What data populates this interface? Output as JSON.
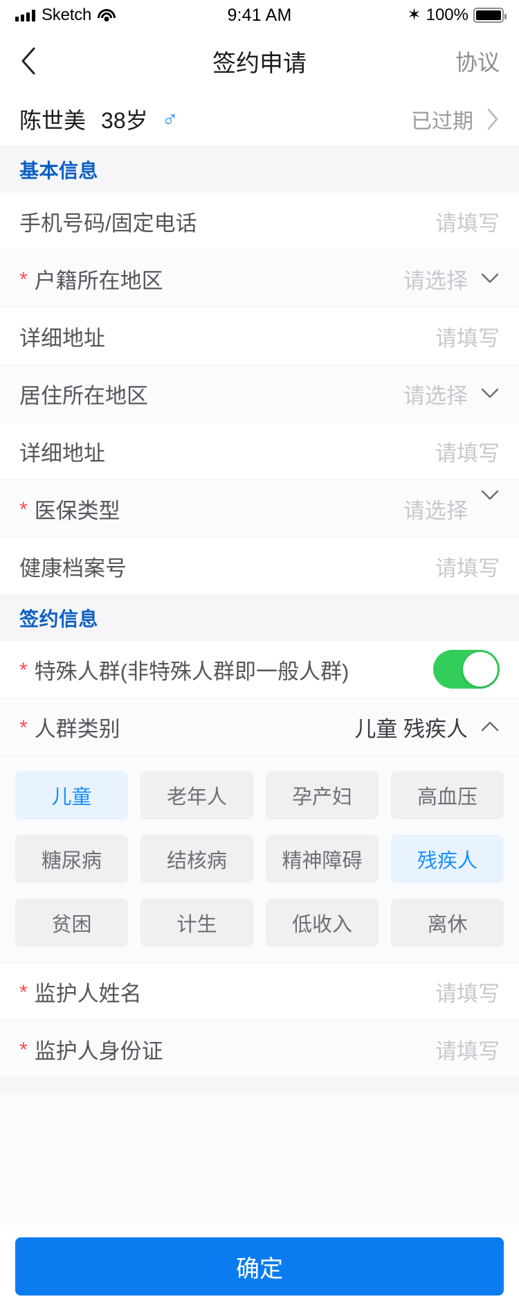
{
  "status_bar": {
    "carrier": "Sketch",
    "time": "9:41 AM",
    "battery_percent": "100%",
    "signal_icon": "signal-bars-icon",
    "wifi_icon": "wifi-icon",
    "bluetooth_icon": "bluetooth-icon",
    "bluetooth_glyph": "✶",
    "battery_icon": "battery-full-icon"
  },
  "nav": {
    "back_icon": "chevron-left-icon",
    "title": "签约申请",
    "right_action": "协议"
  },
  "patient": {
    "name": "陈世美",
    "age": "38岁",
    "gender_icon": "male-gender-icon",
    "gender_glyph": "♂",
    "status": "已过期",
    "chevron_icon": "chevron-right-icon"
  },
  "sections": {
    "basic_info": {
      "title": "基本信息",
      "rows": [
        {
          "label": "手机号码/固定电话",
          "value": "请填写",
          "required": false,
          "type": "input"
        },
        {
          "label": "户籍所在地区",
          "value": "请选择",
          "required": true,
          "type": "select"
        },
        {
          "label": "详细地址",
          "value": "请填写",
          "required": false,
          "type": "input"
        },
        {
          "label": "居住所在地区",
          "value": "请选择",
          "required": false,
          "type": "select"
        },
        {
          "label": "详细地址",
          "value": "请填写",
          "required": false,
          "type": "input"
        },
        {
          "label": "医保类型",
          "value": "请选择",
          "required": true,
          "type": "select-raised"
        },
        {
          "label": "健康档案号",
          "value": "请填写",
          "required": false,
          "type": "input"
        }
      ]
    },
    "sign_info": {
      "title": "签约信息",
      "special_group": {
        "label": "特殊人群(非特殊人群即一般人群)",
        "required": true,
        "toggle_on": true
      },
      "group_category": {
        "label": "人群类别",
        "required": true,
        "value": "儿童 残疾人",
        "chevron_icon": "chevron-up-icon",
        "expanded": true,
        "options": [
          {
            "label": "儿童",
            "selected": true
          },
          {
            "label": "老年人",
            "selected": false
          },
          {
            "label": "孕产妇",
            "selected": false
          },
          {
            "label": "高血压",
            "selected": false
          },
          {
            "label": "糖尿病",
            "selected": false
          },
          {
            "label": "结核病",
            "selected": false
          },
          {
            "label": "精神障碍",
            "selected": false
          },
          {
            "label": "残疾人",
            "selected": true
          },
          {
            "label": "贫困",
            "selected": false
          },
          {
            "label": "计生",
            "selected": false
          },
          {
            "label": "低收入",
            "selected": false
          },
          {
            "label": "离休",
            "selected": false
          }
        ]
      },
      "guardian_rows": [
        {
          "label": "监护人姓名",
          "value": "请填写",
          "required": true,
          "type": "input"
        },
        {
          "label": "监护人身份证",
          "value": "请填写",
          "required": true,
          "type": "input"
        }
      ]
    }
  },
  "footer": {
    "confirm_label": "确定"
  },
  "colors": {
    "accent_blue": "#0b7cf0",
    "section_title_blue": "#0b5fc4",
    "required_red": "#ff4d4f",
    "toggle_green": "#32cd5a",
    "tag_selected_bg": "#e8f3ff",
    "tag_selected_text": "#1890ff"
  }
}
